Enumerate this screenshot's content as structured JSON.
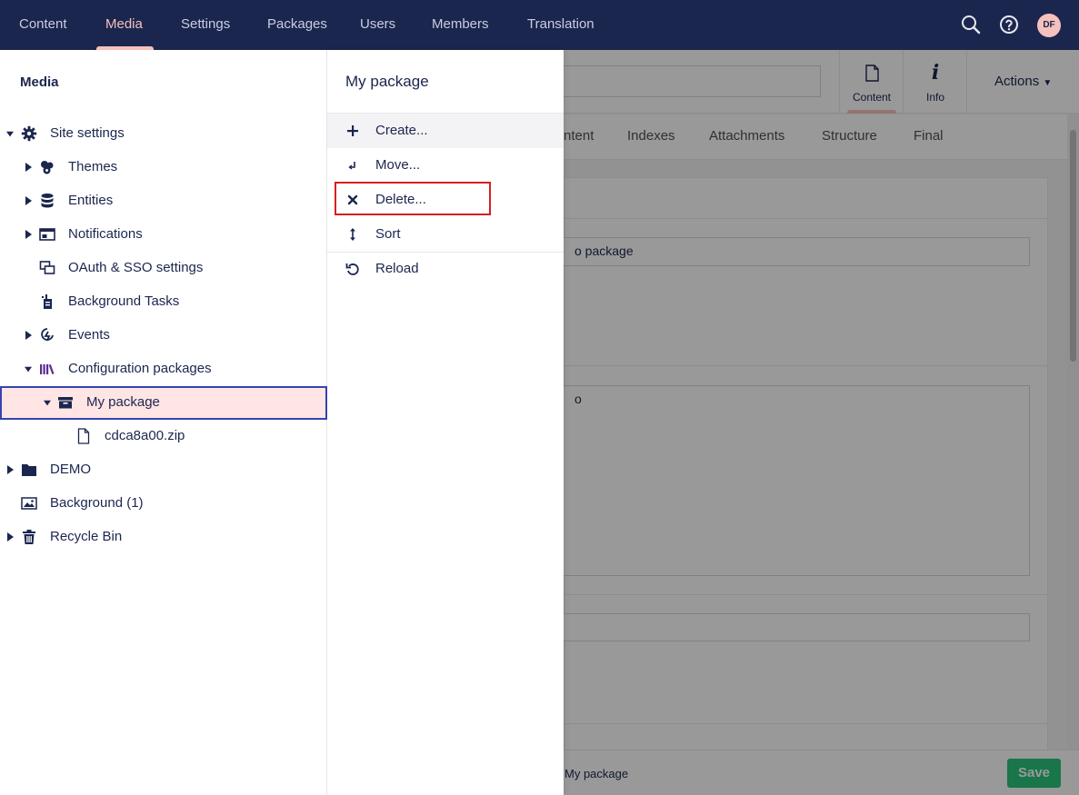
{
  "topnav": {
    "items": [
      {
        "label": "Content"
      },
      {
        "label": "Media"
      },
      {
        "label": "Settings"
      },
      {
        "label": "Packages"
      },
      {
        "label": "Users"
      },
      {
        "label": "Members"
      },
      {
        "label": "Translation"
      }
    ],
    "active": "Media",
    "avatar_initials": "DF",
    "icons": [
      "search-icon",
      "help-icon"
    ]
  },
  "tree": {
    "title": "Media",
    "items": [
      {
        "label": "Site settings",
        "icon": "gear-icon",
        "expanded": true
      },
      {
        "label": "Themes",
        "icon": "palette-icon"
      },
      {
        "label": "Entities",
        "icon": "database-icon"
      },
      {
        "label": "Notifications",
        "icon": "notification-icon"
      },
      {
        "label": "OAuth & SSO settings",
        "icon": "windows-icon"
      },
      {
        "label": "Background Tasks",
        "icon": "tasks-icon"
      },
      {
        "label": "Events",
        "icon": "events-icon"
      },
      {
        "label": "Configuration packages",
        "icon": "library-icon",
        "expanded": true
      },
      {
        "label": "My package",
        "icon": "archive-icon",
        "selected": true
      },
      {
        "label": "cdca8a00.zip",
        "icon": "file-icon"
      },
      {
        "label": "DEMO",
        "icon": "folder-icon"
      },
      {
        "label": "Background (1)",
        "icon": "image-icon"
      },
      {
        "label": "Recycle Bin",
        "icon": "trash-icon"
      }
    ]
  },
  "menu": {
    "title": "My package",
    "items": [
      {
        "label": "Create...",
        "icon": "plus-icon"
      },
      {
        "label": "Move...",
        "icon": "move-icon"
      },
      {
        "label": "Delete...",
        "icon": "delete-icon"
      },
      {
        "label": "Sort",
        "icon": "sort-icon"
      },
      {
        "label": "Reload",
        "icon": "reload-icon"
      }
    ]
  },
  "editor": {
    "apps": [
      {
        "label": "Content",
        "icon": "document-icon"
      },
      {
        "label": "Info",
        "icon": "info-icon"
      }
    ],
    "actions_label": "Actions",
    "tabs": [
      {
        "label": "ntent"
      },
      {
        "label": "Indexes"
      },
      {
        "label": "Attachments"
      },
      {
        "label": "Structure"
      },
      {
        "label": "Final"
      }
    ],
    "field1_value": "o package",
    "field2_value": "o",
    "footer_breadcrumb": "My package",
    "save_label": "Save"
  },
  "colors": {
    "nav_bg": "#1b264f",
    "active_accent": "#f5c1bc",
    "selected_bg": "#ffe5e3",
    "selected_border": "#3544b1",
    "highlight_red": "#d42020",
    "save_green": "#2bc37c"
  }
}
